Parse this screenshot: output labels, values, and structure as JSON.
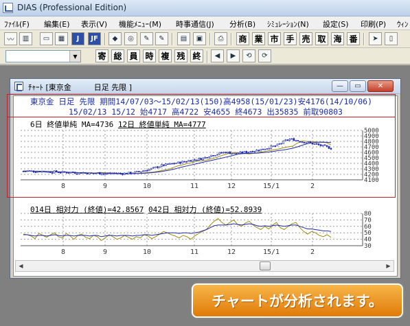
{
  "app": {
    "title": "DIAS (Professional Edition)"
  },
  "menu": [
    "ﾌｧｲﾙ(F)",
    "編集(E)",
    "表示(V)",
    "機能ﾒﾆｭｰ(M)",
    "時事通信(J)",
    "分析(B)",
    "ｼﾐｭﾚｰｼｮﾝ(N)",
    "設定(S)",
    "印刷(P)",
    "ｳｨﾝ"
  ],
  "toolbar1": {
    "icon_buttons": [
      "line-chart-icon",
      "bar-chart-icon",
      "window-icon",
      "table-icon",
      "j-icon",
      "jf-icon",
      "shape-icon",
      "search-icon",
      "note-icon",
      "window-gray-icon",
      "window-blue-icon",
      "print-icon"
    ],
    "icon_glyphs": [
      "〰",
      "▥",
      "▭",
      "▦",
      "J",
      "JF",
      "◆",
      "◎",
      "✎",
      "▤",
      "▣",
      "⎙"
    ],
    "kanji_buttons": [
      "商",
      "業",
      "市",
      "手",
      "売",
      "取",
      "海",
      "番"
    ],
    "pointer_glyph": "➤",
    "doc_glyph": "▯"
  },
  "toolbar2": {
    "combo_value": "",
    "kanji_buttons": [
      "寄",
      "総",
      "員",
      "時",
      "複",
      "残",
      "終"
    ],
    "nav_glyphs": [
      "◀",
      "▶",
      "⟲",
      "⟳"
    ]
  },
  "chart_window": {
    "title": "ﾁｬｰﾄ [東京金　　　日足 先限 ]",
    "controls": {
      "minimize": "—",
      "restore": "▭",
      "close": "✕"
    },
    "info_line1": "東京金 日足 先限 期間14/07/03～15/02/13(150)高4958(15/01/23)安4176(14/10/06)",
    "info_line2": "15/02/13 15/12 始4717 高4722 安4655 終4673 出35835 前取90803",
    "legend_upper": {
      "ma6": "6日 終値単純 MA=4736",
      "ma12": "12日 終値単純 MA=4777"
    },
    "legend_lower": {
      "rsi14": "014日 相対力 (終値)=42.8567",
      "rsi42": "042日 相対力 (終値)=52.8939"
    }
  },
  "chart_data": [
    {
      "type": "line",
      "x_ticks": [
        "8",
        "9",
        "10",
        "11",
        "12",
        "15/1",
        "2"
      ],
      "y_ticks": [
        4100,
        4200,
        4300,
        4400,
        4500,
        4600,
        4700,
        4800,
        4900,
        5000
      ],
      "y_tick_labels": [
        "4100",
        "4200",
        "4300",
        "4400",
        "4500",
        "4600",
        "4700",
        "4800",
        "4900",
        "5000"
      ],
      "ylim": [
        4100,
        5000
      ],
      "series": [
        {
          "name": "6日 終値単純",
          "color": "#a08a10",
          "values": [
            4263,
            4260,
            4257,
            4258,
            4255,
            4250,
            4252,
            4246,
            4243,
            4238,
            4237,
            4232,
            4229,
            4226,
            4221,
            4223,
            4233,
            4227,
            4224,
            4218,
            4220,
            4210,
            4213,
            4216,
            4218,
            4225,
            4233,
            4240,
            4255,
            4272,
            4290,
            4318,
            4350,
            4370,
            4395,
            4410,
            4440,
            4448,
            4456,
            4480,
            4502,
            4535,
            4563,
            4588,
            4600,
            4590,
            4580,
            4573,
            4585,
            4600,
            4612,
            4630,
            4645,
            4660,
            4680,
            4700,
            4713,
            4768,
            4808,
            4800,
            4795,
            4790,
            4781,
            4777,
            4736
          ]
        },
        {
          "name": "12日 終値単純",
          "color": "#1e2aa8",
          "values": [
            4258,
            4258,
            4256,
            4255,
            4253,
            4250,
            4248,
            4245,
            4242,
            4239,
            4236,
            4233,
            4230,
            4227,
            4224,
            4222,
            4222,
            4222,
            4221,
            4220,
            4219,
            4216,
            4215,
            4214,
            4216,
            4219,
            4225,
            4232,
            4242,
            4255,
            4270,
            4288,
            4310,
            4332,
            4352,
            4373,
            4393,
            4413,
            4433,
            4450,
            4470,
            4490,
            4510,
            4530,
            4552,
            4572,
            4580,
            4582,
            4585,
            4587,
            4597,
            4605,
            4618,
            4632,
            4643,
            4657,
            4675,
            4700,
            4730,
            4756,
            4775,
            4783,
            4788,
            4785,
            4777
          ]
        }
      ]
    },
    {
      "type": "line",
      "x_ticks": [
        "8",
        "9",
        "10",
        "11",
        "12",
        "15/1",
        "2"
      ],
      "y_ticks": [
        30,
        40,
        50,
        60,
        70,
        80
      ],
      "y_tick_labels": [
        "30",
        "40",
        "50",
        "60",
        "70",
        "80"
      ],
      "ylim": [
        30,
        80
      ],
      "series": [
        {
          "name": "014日 相対力 (終値)",
          "color": "#a08a10",
          "values": [
            48,
            47,
            45,
            41,
            49,
            46,
            43,
            47,
            50,
            44,
            42,
            49,
            45,
            40,
            46,
            48,
            43,
            41,
            46,
            44,
            38,
            42,
            47,
            44,
            40,
            42,
            46,
            43,
            40,
            44,
            42,
            47,
            45,
            41,
            44,
            48,
            52,
            50,
            47,
            45,
            42,
            46,
            44,
            40,
            45,
            49,
            52,
            55,
            62,
            68,
            72,
            66,
            62,
            66,
            70,
            63,
            60,
            65,
            68,
            62,
            58,
            55,
            60,
            56,
            62,
            66,
            58,
            55,
            60,
            64,
            66,
            58,
            52,
            48,
            52,
            50,
            46,
            44,
            47,
            43
          ]
        },
        {
          "name": "042日 相対力 (終値)",
          "color": "#1e2aa8",
          "values": [
            47,
            47,
            46,
            45,
            46,
            46,
            45,
            46,
            47,
            46,
            45,
            46,
            46,
            45,
            46,
            46,
            46,
            45,
            46,
            46,
            44,
            45,
            46,
            46,
            45,
            46,
            46,
            46,
            45,
            46,
            46,
            47,
            47,
            46,
            47,
            48,
            49,
            50,
            50,
            50,
            49,
            50,
            50,
            49,
            50,
            51,
            53,
            55,
            58,
            61,
            62,
            62,
            62,
            63,
            64,
            63,
            62,
            63,
            64,
            63,
            61,
            60,
            61,
            60,
            61,
            62,
            61,
            60,
            61,
            62,
            62,
            60,
            58,
            56,
            56,
            55,
            54,
            53,
            53,
            52
          ]
        }
      ]
    }
  ],
  "candles": {
    "count": 150,
    "close_path": "4258,4262,4255,4251,4260,4248,4243,4247,4239,4235,4240,4230,4226,4232,4222,4219,4226,4214,4210,4218,4224,4210,4215,4222,4233,4245,4262,4283,4304,4330,4358,4372,4388,4402,4415,4432,4450,4460,4475,4490,4520,4550,4565,4590,4605,4590,4575,4585,4600,4612,4628,4640,4655,4678,4700,4720,4760,4810,4840,4830,4805,4790,4782,4760,4740,4720,4700,4673"
  },
  "banner": {
    "text": "チャートが分析されます。"
  }
}
